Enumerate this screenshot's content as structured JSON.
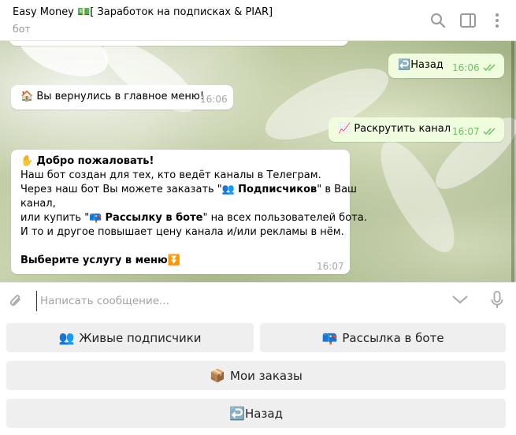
{
  "header": {
    "title": "Easy Money 💵[ Заработок на подписках & PIAR]",
    "subtitle": "бот"
  },
  "messages": [
    {
      "side": "out",
      "emoji": "↩️",
      "text": "Назад",
      "time": "16:06",
      "read": true
    },
    {
      "side": "in",
      "emoji": "🏠",
      "text": "Вы вернулись в главное меню!",
      "time": "16:06"
    },
    {
      "side": "out",
      "emoji": "📈",
      "text": "Раскрутить канал",
      "time": "16:07",
      "read": true
    },
    {
      "side": "in",
      "time": "16:07",
      "lines": {
        "l1_emoji": "✋",
        "l1": "Добро пожаловать!",
        "l2": "Наш бот создан для тех, кто ведёт каналы в Телеграм.",
        "l3a": "Через наш бот Вы можете заказать \"",
        "l3_emoji": "👥",
        "l3b": "Подписчиков",
        "l3c": "\" в Ваш",
        "l4": "канал,",
        "l5a": "или купить  \"",
        "l5_emoji": "📪",
        "l5b": "Рассылку в боте",
        "l5c": "\" на всех пользователей бота.",
        "l6": "И то и другое повышает цену канала и/или рекламы в нём.",
        "l7": "Выберите услугу в меню",
        "l7_emoji": "⏬"
      }
    }
  ],
  "composer": {
    "placeholder": "Написать сообщение..."
  },
  "keyboard": {
    "rows": [
      [
        {
          "emoji": "👥",
          "label": "Живые подписчики"
        },
        {
          "emoji": "📪",
          "label": "Рассылка в боте"
        }
      ],
      [
        {
          "emoji": "📦",
          "label": "Мои заказы"
        }
      ],
      [
        {
          "emoji": "↩️",
          "label": "Назад"
        }
      ]
    ]
  },
  "icons": {
    "header": [
      "search-icon",
      "sidebar-toggle-icon",
      "more-vertical-icon"
    ],
    "composer": [
      "attach-icon",
      "scroll-down-icon",
      "microphone-icon"
    ]
  },
  "colors": {
    "incoming": "#ffffff",
    "outgoing": "#effdde",
    "outgoing_meta": "#6cc264",
    "keyboard_button": "#efefef"
  }
}
